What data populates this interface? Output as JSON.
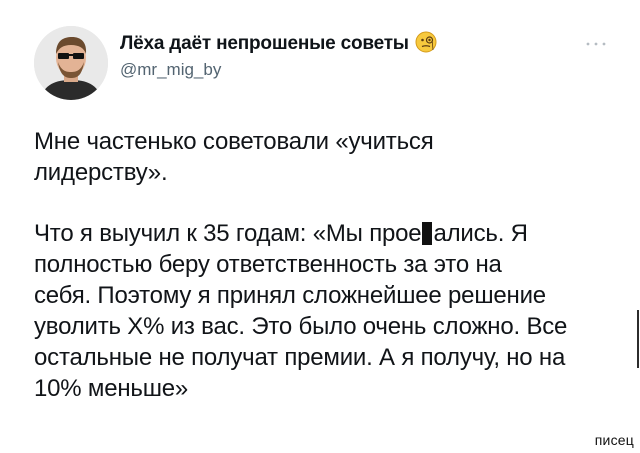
{
  "author": {
    "display_name": "Лёха даёт непрошеные советы",
    "emoji": "face-with-monocle",
    "handle": "@mr_mig_by"
  },
  "more_icon": "more-dots-icon",
  "tweet": {
    "para1": "Мне частенько советовали «учиться\nлидерству».",
    "para2_a": "Что я выучил к 35 годам: «Мы прое",
    "para2_b": "ались. Я\nполностью беру ответственность за это на\nсебя. Поэтому я принял сложнейшее решение\nуволить X% из вас. Это было очень сложно. Все\nостальные не получат премии. А я получу, но на\n10% меньше»"
  },
  "watermark": "писец",
  "colors": {
    "text": "#0f1419",
    "handle": "#536471",
    "background": "#ffffff"
  }
}
